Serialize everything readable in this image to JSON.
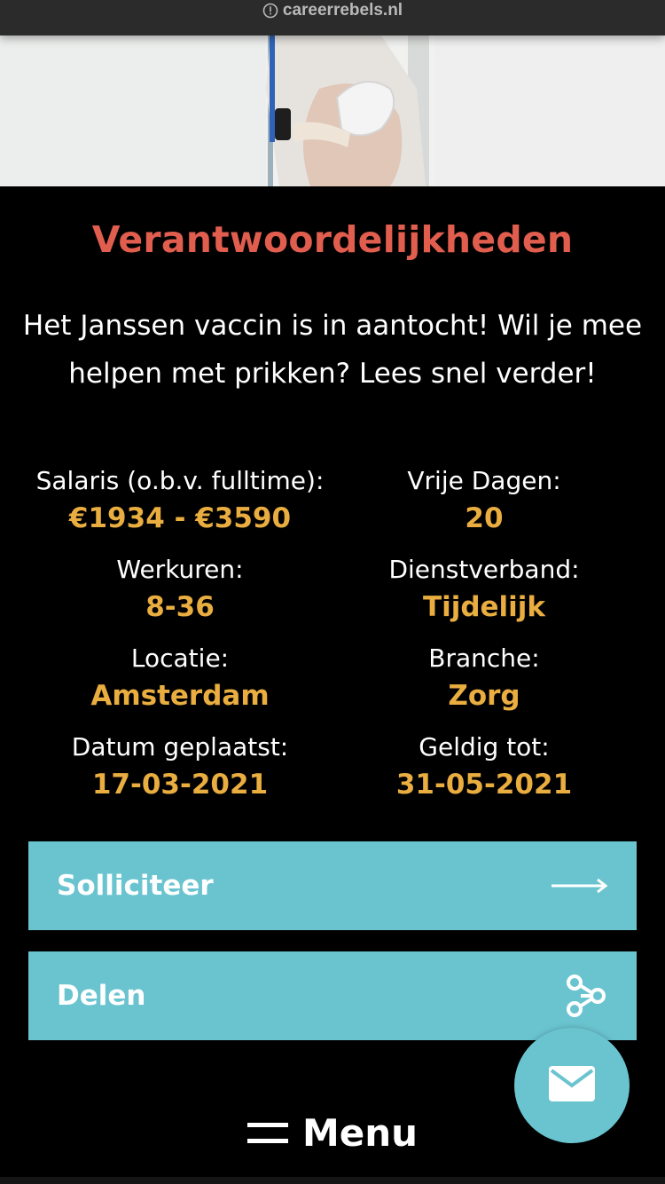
{
  "browser": {
    "url": "careerrebels.nl",
    "info_icon": "info-circle-icon"
  },
  "hero": {
    "image": "nurse-giving-vaccine-photo"
  },
  "section": {
    "title": "Verantwoordelijkheden",
    "intro": "Het Janssen vaccin is in aantocht! Wil je mee helpen met prikken? Lees snel verder!"
  },
  "facts": [
    {
      "label": "Salaris (o.b.v. fulltime):",
      "value": "€1934 - €3590"
    },
    {
      "label": "Vrije Dagen:",
      "value": "20"
    },
    {
      "label": "Werkuren:",
      "value": "8-36"
    },
    {
      "label": "Dienstverband:",
      "value": "Tijdelijk"
    },
    {
      "label": "Locatie:",
      "value": "Amsterdam"
    },
    {
      "label": "Branche:",
      "value": "Zorg"
    },
    {
      "label": "Datum geplaatst:",
      "value": "17-03-2021"
    },
    {
      "label": "Geldig tot:",
      "value": "31-05-2021"
    }
  ],
  "actions": {
    "apply_label": "Solliciteer",
    "apply_icon": "arrow-right-icon",
    "share_label": "Delen",
    "share_icon": "share-nodes-icon"
  },
  "menu": {
    "label": "Menu",
    "icon": "hamburger-icon"
  },
  "fab": {
    "icon": "mail-icon"
  },
  "colors": {
    "title": "#e15e4f",
    "value": "#e9ad40",
    "button": "#6ac4d0",
    "background": "#000000"
  }
}
